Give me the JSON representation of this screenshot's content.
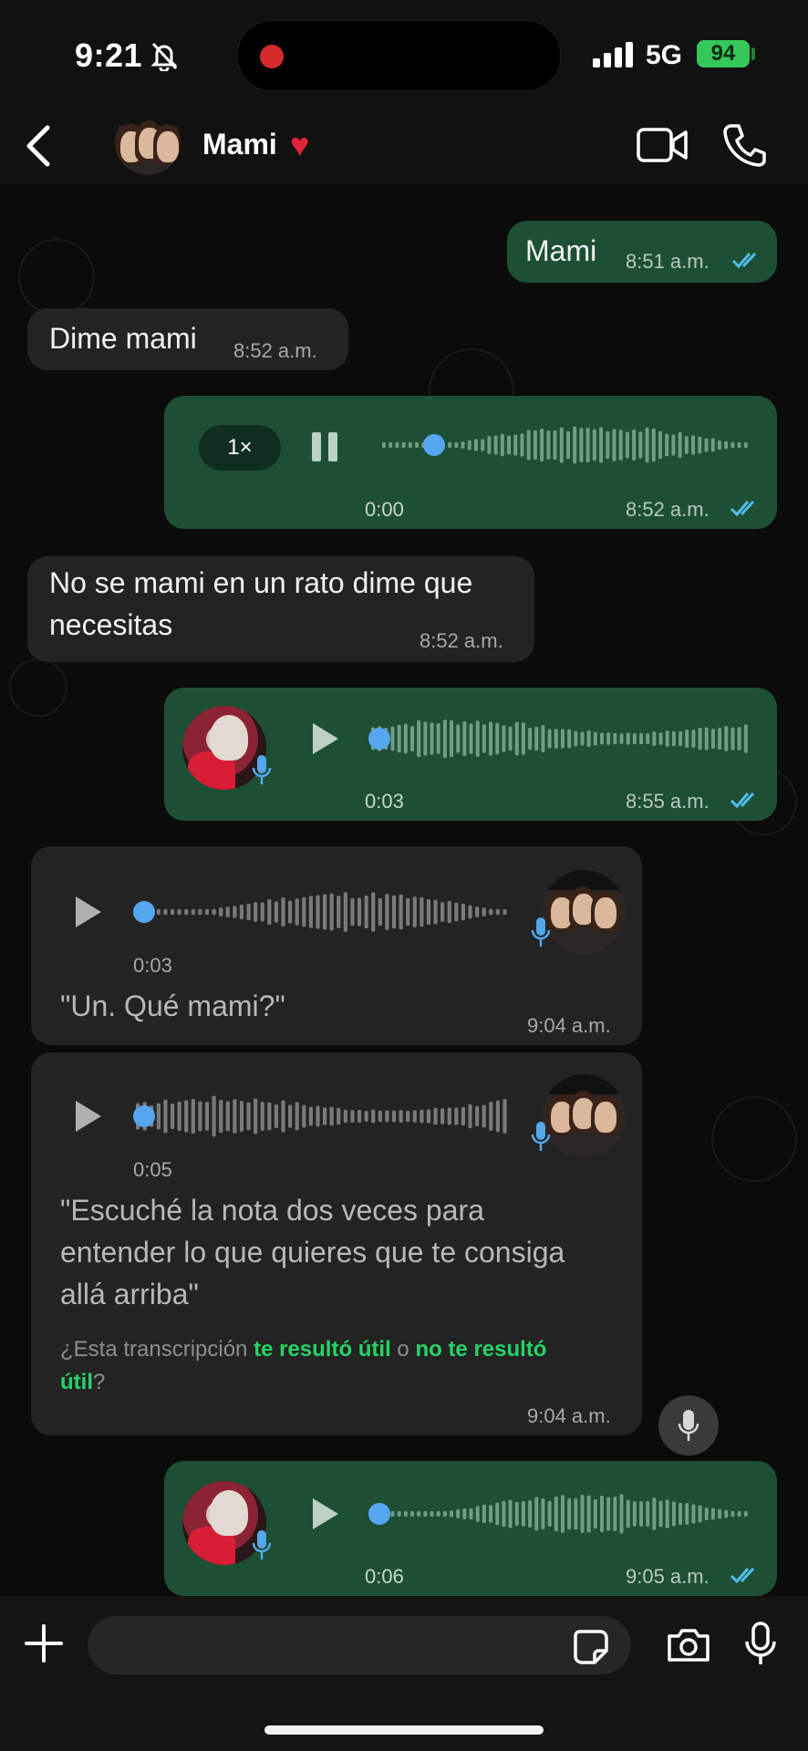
{
  "status_bar": {
    "time": "9:21",
    "network": "5G",
    "battery": "94"
  },
  "header": {
    "contact_name": "Mami",
    "heart": "❤️"
  },
  "messages": [
    {
      "type": "text",
      "direction": "out",
      "text": "Mami",
      "time": "8:51 a.m."
    },
    {
      "type": "text",
      "direction": "in",
      "text": "Dime mami",
      "time": "8:52 a.m."
    },
    {
      "type": "voice",
      "direction": "out",
      "speed": "1×",
      "state": "playing",
      "duration": "0:00",
      "time": "8:52 a.m."
    },
    {
      "type": "text",
      "direction": "in",
      "text": "No se mami en un rato dime que necesitas",
      "time": "8:52 a.m."
    },
    {
      "type": "voice",
      "direction": "out",
      "duration": "0:03",
      "time": "8:55 a.m."
    },
    {
      "type": "voice",
      "direction": "in",
      "duration": "0:03",
      "transcript": "\"Un. Qué mami?\"",
      "time": "9:04 a.m."
    },
    {
      "type": "voice",
      "direction": "in",
      "duration": "0:05",
      "transcript": "\"Escuché la nota dos veces para entender lo que quieres que te consiga allá arriba\"",
      "time": "9:04 a.m.",
      "feedback": {
        "prefix": "¿Esta transcripción ",
        "useful": "te resultó útil",
        "or": " o ",
        "not_useful": "no te resultó útil",
        "suffix": "?"
      }
    },
    {
      "type": "voice",
      "direction": "out",
      "duration": "0:06",
      "time": "9:05 a.m."
    }
  ],
  "composer": {
    "placeholder": ""
  },
  "colors": {
    "outgoing": "#1d4f35",
    "incoming": "#232323",
    "accent": "#25d366",
    "read_ticks": "#53bdeb"
  },
  "icons": [
    "back-chevron-icon",
    "video-call-icon",
    "phone-call-icon",
    "play-icon",
    "pause-icon",
    "mic-icon",
    "plus-icon",
    "sticker-icon",
    "camera-icon",
    "chevron-down-icon",
    "double-check-icon",
    "muted-bell-icon"
  ]
}
